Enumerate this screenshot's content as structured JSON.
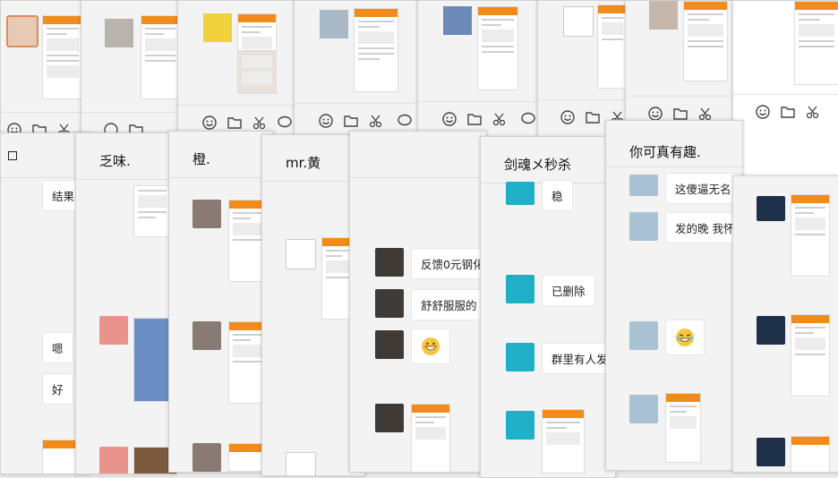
{
  "windows": [
    {
      "title": "",
      "messages": [
        "结果",
        "嗯",
        "好"
      ]
    },
    {
      "title": "乏味."
    },
    {
      "title": "橙."
    },
    {
      "title": "mr.黄"
    },
    {
      "title": "",
      "messages": [
        "反馈0元钢化",
        "舒舒服服的"
      ]
    },
    {
      "title": "剑魂メ秒杀",
      "messages": [
        "稳",
        "已删除",
        "群里有人发"
      ]
    },
    {
      "title": "你可真有趣.",
      "messages": [
        "这傻逼无名",
        "发的晚 我怀"
      ]
    }
  ],
  "icons": {
    "emoji": "smiley-icon",
    "folder": "folder-icon",
    "scissors": "scissors-icon",
    "chat": "chat-bubble-icon"
  },
  "colors": {
    "accent": "#f28b1c",
    "window_bg": "#f3f3f3",
    "bubble_bg": "#ffffff"
  }
}
